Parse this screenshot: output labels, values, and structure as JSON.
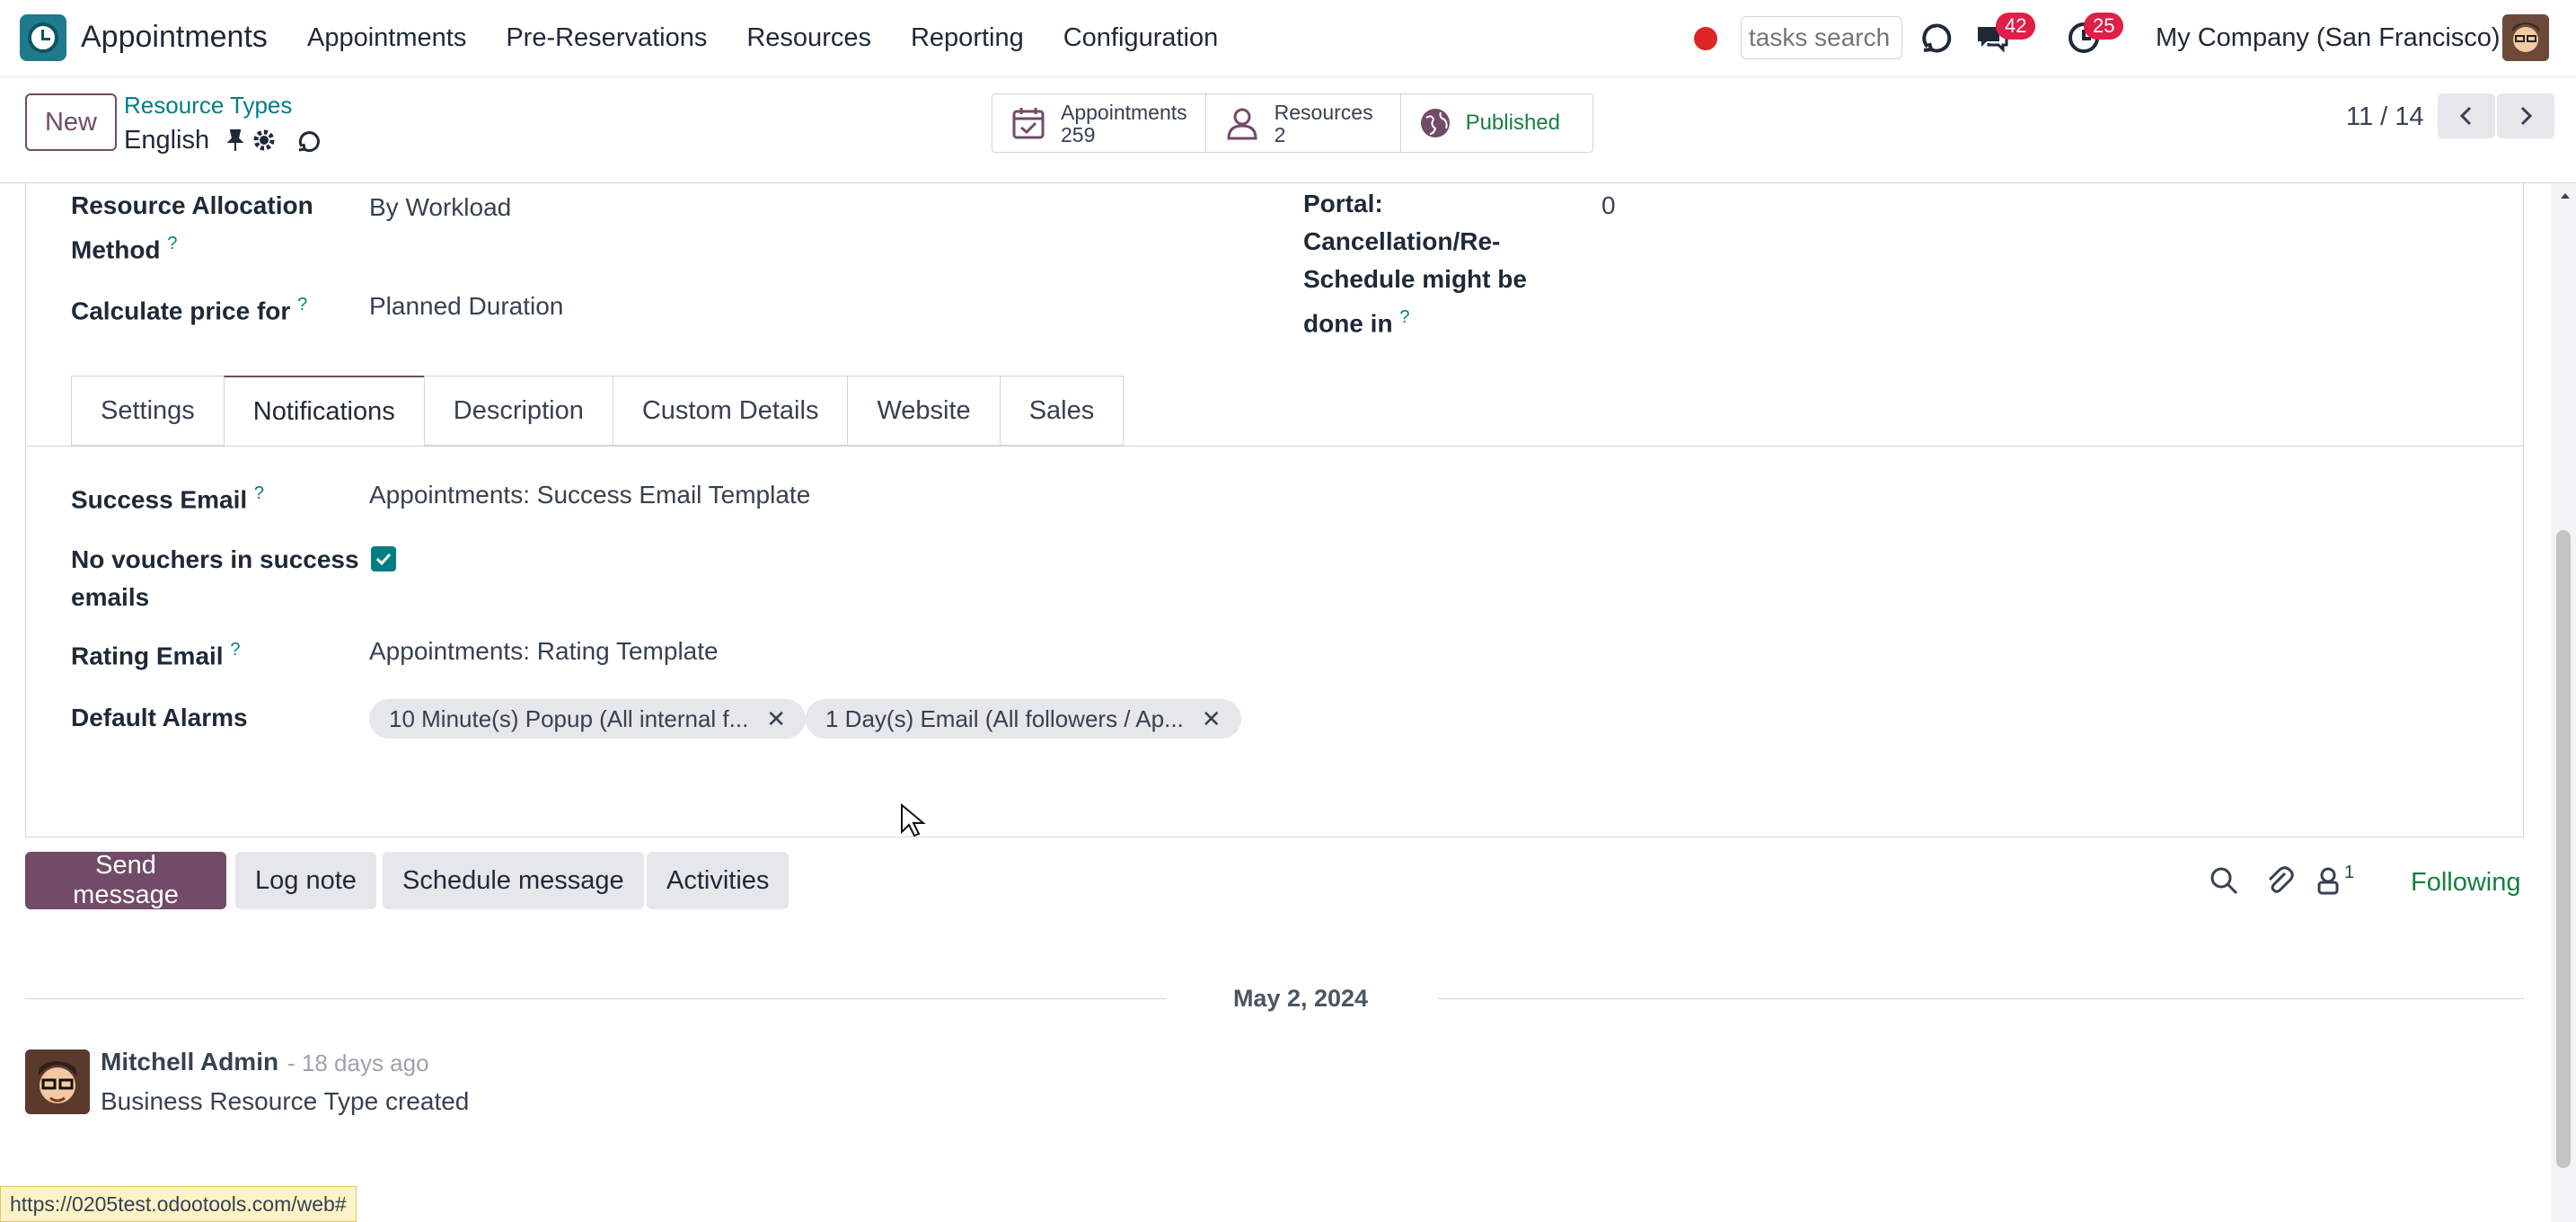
{
  "navbar": {
    "app_name": "Appointments",
    "menu": [
      "Appointments",
      "Pre-Reservations",
      "Resources",
      "Reporting",
      "Configuration"
    ],
    "search_placeholder": "tasks search",
    "messages_count": "42",
    "activities_count": "25",
    "company": "My Company (San Francisco)"
  },
  "control": {
    "new_label": "New",
    "breadcrumb": "Resource Types",
    "record_name": "English",
    "smart_buttons": {
      "appointments_label": "Appointments",
      "appointments_value": "259",
      "resources_label": "Resources",
      "resources_value": "2",
      "published_label": "Published"
    },
    "pager": "11 / 14"
  },
  "form": {
    "allocation_label": "Resource Allocation Method",
    "allocation_value": "By Workload",
    "price_label": "Calculate price for",
    "price_value": "Planned Duration",
    "portal_label": "Portal: Cancellation/Re-Schedule might be done in",
    "portal_value": "0",
    "tabs": [
      "Settings",
      "Notifications",
      "Description",
      "Custom Details",
      "Website",
      "Sales"
    ],
    "success_email_label": "Success Email",
    "success_email_value": "Appointments: Success Email Template",
    "no_vouchers_label": "No vouchers in success emails",
    "rating_email_label": "Rating Email",
    "rating_email_value": "Appointments: Rating Template",
    "default_alarms_label": "Default Alarms",
    "alarms": [
      "10 Minute(s) Popup (All internal f...",
      "1 Day(s) Email (All followers / Ap..."
    ],
    "help_mark": "?"
  },
  "chatter": {
    "send_message": "Send message",
    "log_note": "Log note",
    "schedule_message": "Schedule message",
    "activities": "Activities",
    "followers_count": "1",
    "following": "Following",
    "date": "May 2, 2024",
    "author": "Mitchell Admin",
    "time": "- 18 days ago",
    "body": "Business Resource Type created"
  },
  "status_url": "https://0205test.odootools.com/web#",
  "colors": {
    "primary": "#714b67",
    "teal": "#017e84",
    "badge": "#e11d48",
    "success": "#15803d"
  }
}
